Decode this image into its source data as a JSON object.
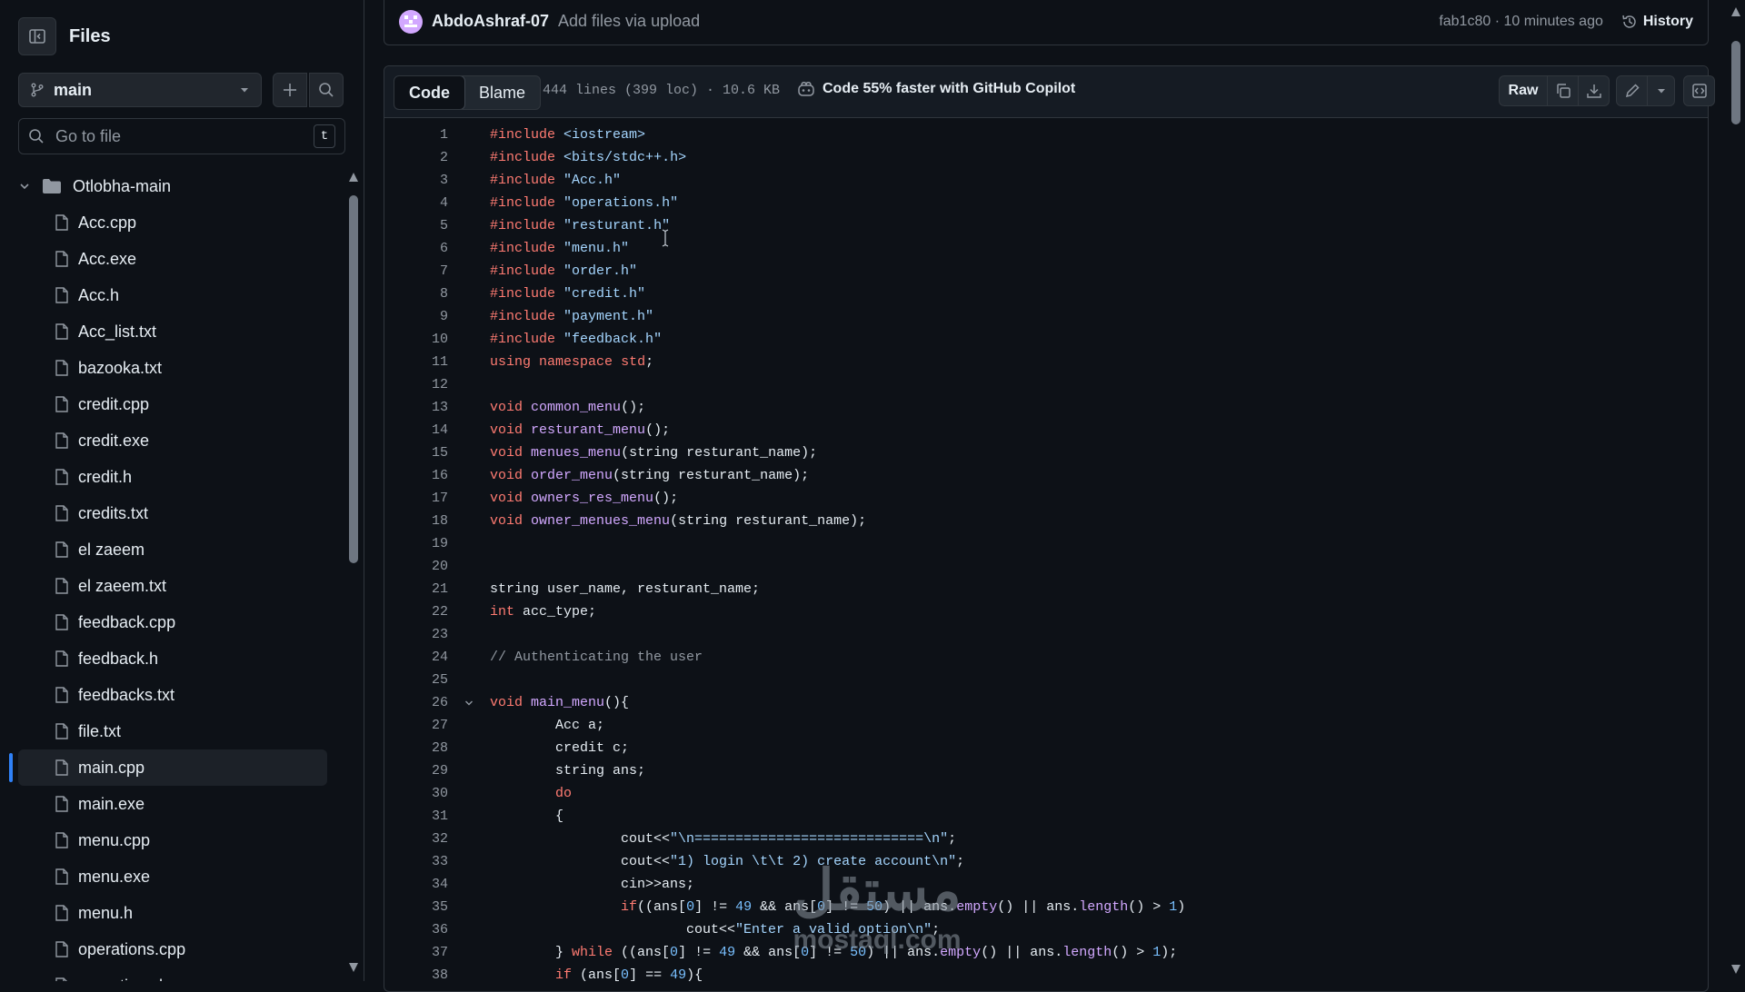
{
  "sidebar": {
    "title": "Files",
    "branch": "main",
    "goto_placeholder": "Go to file",
    "goto_shortcut": "t",
    "folder": "Otlobha-main",
    "files": [
      "Acc.cpp",
      "Acc.exe",
      "Acc.h",
      "Acc_list.txt",
      "bazooka.txt",
      "credit.cpp",
      "credit.exe",
      "credit.h",
      "credits.txt",
      "el zaeem",
      "el zaeem.txt",
      "feedback.cpp",
      "feedback.h",
      "feedbacks.txt",
      "file.txt",
      "main.cpp",
      "main.exe",
      "menu.cpp",
      "menu.exe",
      "menu.h",
      "operations.cpp",
      "operations.h"
    ],
    "selected_file": "main.cpp"
  },
  "commit": {
    "author": "AbdoAshraf-07",
    "message": "Add files via upload",
    "meta": "fab1c80 · 10 minutes ago",
    "history_label": "History"
  },
  "file_header": {
    "tab_code": "Code",
    "tab_blame": "Blame",
    "info": "444 lines (399 loc) · 10.6 KB",
    "copilot": "Code 55% faster with GitHub Copilot",
    "raw_label": "Raw"
  },
  "code": {
    "lines": [
      "#include <iostream>",
      "#include <bits/stdc++.h>",
      "#include \"Acc.h\"",
      "#include \"operations.h\"",
      "#include \"resturant.h\"",
      "#include \"menu.h\"",
      "#include \"order.h\"",
      "#include \"credit.h\"",
      "#include \"payment.h\"",
      "#include \"feedback.h\"",
      "using namespace std;",
      "",
      "void common_menu();",
      "void resturant_menu();",
      "void menues_menu(string resturant_name);",
      "void order_menu(string resturant_name);",
      "void owners_res_menu();",
      "void owner_menues_menu(string resturant_name);",
      "",
      "",
      "string user_name, resturant_name;",
      "int acc_type;",
      "",
      "// Authenticating the user",
      "",
      "void main_menu(){",
      "        Acc a;",
      "        credit c;",
      "        string ans;",
      "        do",
      "        {",
      "                cout<<\"\\n============================\\n\";",
      "                cout<<\"1) login \\t\\t 2) create account\\n\";",
      "                cin>>ans;",
      "                if((ans[0] != 49 && ans[0] != 50) || ans.empty() || ans.length() > 1)",
      "                        cout<<\"Enter a valid option\\n\";",
      "        } while ((ans[0] != 49 && ans[0] != 50) || ans.empty() || ans.length() > 1);",
      "        if (ans[0] == 49){"
    ]
  },
  "watermark": {
    "arabic": "مستقل",
    "latin": "mostaql.com"
  },
  "colors": {
    "keyword": "#ff7b72",
    "function": "#d2a8ff",
    "string": "#a5d6ff",
    "number": "#79c0ff",
    "accent": "#2f81f7"
  }
}
